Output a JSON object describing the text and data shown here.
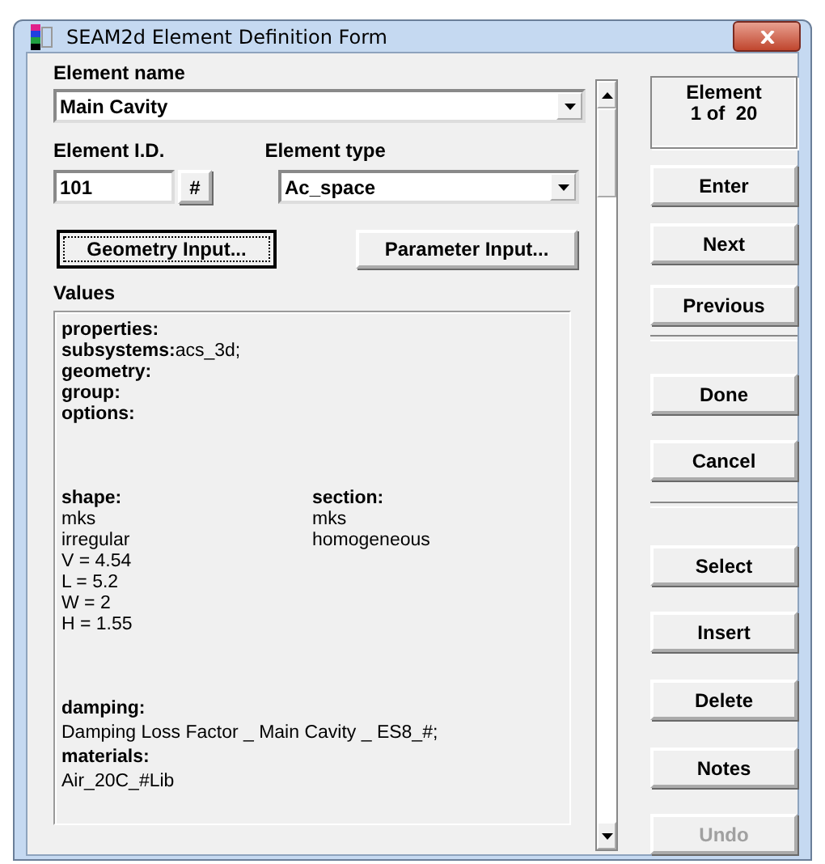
{
  "window": {
    "title": "SEAM2d Element Definition Form"
  },
  "element_name": {
    "label": "Element name",
    "value": "Main Cavity"
  },
  "element_id": {
    "label": "Element I.D.",
    "value": "101",
    "button": "#"
  },
  "element_type": {
    "label": "Element type",
    "value": "Ac_space"
  },
  "input_buttons": [
    {
      "label": "Geometry Input...",
      "focused": true
    },
    {
      "label": "Parameter Input...",
      "focused": false
    }
  ],
  "values": {
    "label": "Values",
    "fields": [
      {
        "label": "properties:"
      },
      {
        "label": "subsystems:",
        "value": "acs_3d;"
      },
      {
        "label": "geometry:"
      },
      {
        "label": "group:"
      },
      {
        "label": "options:"
      }
    ],
    "columns": [
      {
        "label": "shape:",
        "lines": [
          "mks",
          "irregular",
          "V = 4.54",
          "L = 5.2",
          "W = 2",
          "H = 1.55"
        ]
      },
      {
        "label": "section:",
        "lines": [
          "mks",
          "homogeneous"
        ]
      }
    ],
    "blocks": [
      {
        "label": "damping:",
        "lines": [
          "Damping Loss Factor _ Main Cavity _ ES8_#;"
        ]
      },
      {
        "label": "materials:",
        "lines": [
          "Air_20C_#Lib"
        ]
      }
    ]
  },
  "counter": {
    "lines": [
      "Element",
      "1 of  20"
    ]
  },
  "buttons": [
    {
      "kind": "button",
      "label": "Enter",
      "disabled": false
    },
    {
      "kind": "button",
      "label": "Next",
      "disabled": false
    },
    {
      "kind": "button",
      "label": "Previous",
      "disabled": false
    },
    {
      "kind": "separator"
    },
    {
      "kind": "button",
      "label": "Done",
      "disabled": false
    },
    {
      "kind": "button",
      "label": "Cancel",
      "disabled": false
    },
    {
      "kind": "separator"
    },
    {
      "kind": "button",
      "label": "Select",
      "disabled": false
    },
    {
      "kind": "button",
      "label": "Insert",
      "disabled": false
    },
    {
      "kind": "button",
      "label": "Delete",
      "disabled": false
    },
    {
      "kind": "button",
      "label": "Notes",
      "disabled": false
    },
    {
      "kind": "button",
      "label": "Undo",
      "disabled": true
    }
  ]
}
